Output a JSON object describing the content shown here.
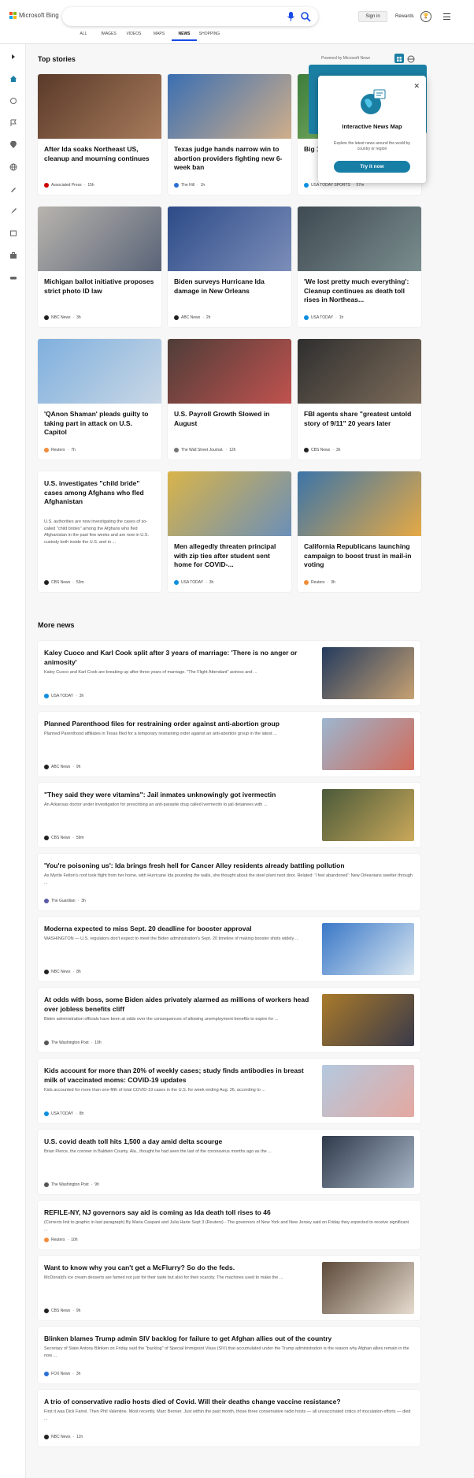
{
  "header": {
    "logo_text": "Microsoft Bing",
    "signin_label": "Sign in",
    "rewards_label": "Rewards",
    "tabs": [
      "ALL",
      "IMAGES",
      "VIDEOS",
      "MAPS",
      "NEWS",
      "SHOPPING"
    ],
    "active_tab": "NEWS"
  },
  "colors": {
    "accent": "#174ae4",
    "popup_button": "#177ea6"
  },
  "top_stories": {
    "title": "Top stories",
    "powered_by": "Powered by Microsoft News",
    "cards": [
      {
        "title": "After Ida soaks Northeast US, cleanup and mourning continues",
        "source": "Associated Press",
        "time": "15h"
      },
      {
        "title": "Texas judge hands narrow win to abortion providers fighting new 6-week ban",
        "source": "The Hill",
        "time": "1h"
      },
      {
        "title": "Big 1 new s BYU,",
        "source": "USA TODAY SPORTS",
        "time": "57m"
      },
      {
        "title": "Michigan ballot initiative proposes strict photo ID law",
        "source": "NBC News",
        "time": "3h"
      },
      {
        "title": "Biden surveys Hurricane Ida damage in New Orleans",
        "source": "ABC News",
        "time": "2h"
      },
      {
        "title": "'We lost pretty much everything': Cleanup continues as death toll rises in Northeas...",
        "source": "USA TODAY",
        "time": "1h"
      },
      {
        "title": "'QAnon Shaman' pleads guilty to taking part in attack on U.S. Capitol",
        "source": "Reuters",
        "time": "7h"
      },
      {
        "title": "U.S. Payroll Growth Slowed in August",
        "source": "The Wall Street Journal.",
        "time": "12h"
      },
      {
        "title": "FBI agents share \"greatest untold story of 9/11\" 20 years later",
        "source": "CBS News",
        "time": "3h"
      },
      {
        "title": "U.S. investigates \"child bride\" cases among Afghans who fled Afghanistan",
        "snippet": "U.S. authorities are now investigating the cases of so-called \"child brides\" among the Afghans who fled Afghanistan in the past few weeks and are now in U.S. custody both inside the U.S. and in ...",
        "source": "CBS News",
        "time": "53m"
      },
      {
        "title": "Men allegedly threaten principal with zip ties after student sent home for COVID-...",
        "source": "USA TODAY",
        "time": "3h"
      },
      {
        "title": "California Republicans launching campaign to boost trust in mail-in voting",
        "source": "Reuters",
        "time": "3h"
      }
    ]
  },
  "popup": {
    "title": "Interactive News Map",
    "description": "Explore the latest news around the world by country or region",
    "button": "Try it now"
  },
  "more_news": {
    "title": "More news",
    "items": [
      {
        "title": "Kaley Cuoco and Karl Cook split after 3 years of marriage: 'There is no anger or animosity'",
        "snippet": "Kaley Cuoco and Karl Cook are breaking up after three years of marriage. \"The Flight Attendant\" actress and ...",
        "source": "USA TODAY",
        "time": "3h"
      },
      {
        "title": "Planned Parenthood files for restraining order against anti-abortion group",
        "snippet": "Planned Parenthood affiliates in Texas filed for a temporary restraining order against an anti-abortion group in the latest ...",
        "source": "ABC News",
        "time": "9h"
      },
      {
        "title": "\"They said they were vitamins\": Jail inmates unknowingly got ivermectin",
        "snippet": "An Arkansas doctor under investigation for prescribing an anti-parasite drug called ivermectin to jail detainees with ...",
        "source": "CBS News",
        "time": "59m"
      },
      {
        "title": "'You're poisoning us': Ida brings fresh hell for Cancer Alley residents already battling pollution",
        "snippet": "As Myrtle Felton's roof took flight from her home, with Hurricane Ida pounding the walls, she thought about the steel plant next door. Related: 'I feel abandoned': New Orleanians swelter through ...",
        "source": "The Guardian",
        "time": "3h"
      },
      {
        "title": "Moderna expected to miss Sept. 20 deadline for booster approval",
        "snippet": "WASHINGTON — U.S. regulators don't expect to meet the Biden administration's Sept. 20 timeline of making booster shots widely ...",
        "source": "NBC News",
        "time": "8h"
      },
      {
        "title": "At odds with boss, some Biden aides privately alarmed as millions of workers head over jobless benefits cliff",
        "snippet": "Biden administration officials have been at odds over the consequences of allowing unemployment benefits to expire for ...",
        "source": "The Washington Post",
        "time": "10h"
      },
      {
        "title": "Kids account for more than 20% of weekly cases; study finds antibodies in breast milk of vaccinated moms: COVID-19 updates",
        "snippet": "Kids accounted for more than one-fifth of total COVID-19 cases in the U.S. for week ending Aug. 26, according to ...",
        "source": "USA TODAY",
        "time": "8h"
      },
      {
        "title": "U.S. covid death toll hits 1,500 a day amid delta scourge",
        "snippet": "Brian Pierce, the coroner in Baldwin County, Ala., thought he had seen the last of the coronavirus months ago as the ...",
        "source": "The Washington Post",
        "time": "9h"
      },
      {
        "title": "REFILE-NY, NJ governors say aid is coming as Ida death toll rises to 46",
        "snippet": "(Corrects link to graphic in last paragraph) By Maria Caspani and Julia Harte Sept 3 (Reuters) - The governors of New York and New Jersey said on Friday they expected to receive significant ...",
        "source": "Reuters",
        "time": "10h"
      },
      {
        "title": "Want to know why you can't get a McFlurry? So do the feds.",
        "snippet": "McDonald's ice cream desserts are famed not just for their taste but also for their scarcity. The machines used to make the ...",
        "source": "CBS News",
        "time": "9h"
      },
      {
        "title": "Blinken blames Trump admin SIV backlog for failure to get Afghan allies out of the country",
        "snippet": "Secretary of State Antony Blinken on Friday said the \"backlog\" of Special Immigrant Visas (SIV) that accumulated under the Trump administration is the reason why Afghan allies remain in the now ...",
        "source": "FOX News",
        "time": "3h"
      },
      {
        "title": "A trio of conservative radio hosts died of Covid. Will their deaths change vaccine resistance?",
        "snippet": "First it was Dick Farrel. Then Phil Valentine. Most recently, Marc Bernier. Just within the past month, those three conservative radio hosts — all unvaccinated critics of inoculation efforts — died ...",
        "source": "NBC News",
        "time": "11h"
      }
    ]
  }
}
